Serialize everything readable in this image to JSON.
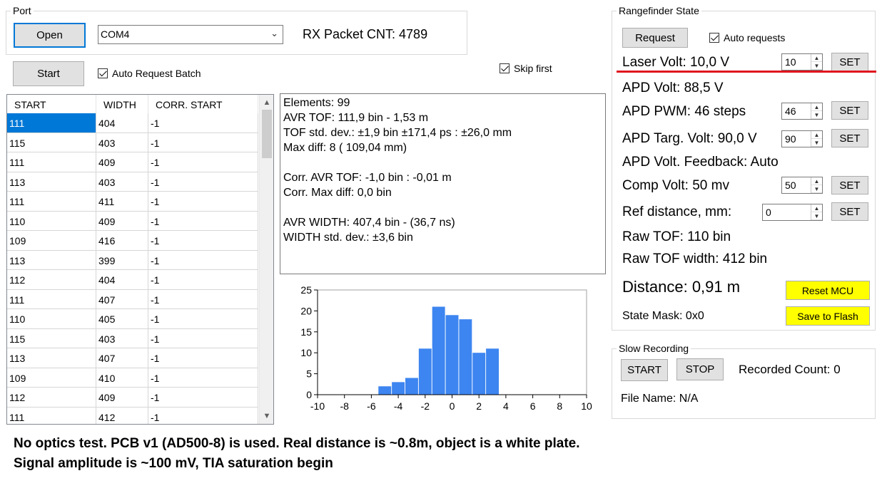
{
  "port": {
    "group_title": "Port",
    "open_label": "Open",
    "com_value": "COM4",
    "rx_packet": "RX Packet CNT: 4789",
    "start_label": "Start",
    "auto_request_batch": "Auto Request Batch",
    "skip_first": "Skip first"
  },
  "table": {
    "columns": [
      "START",
      "WIDTH",
      "CORR. START"
    ],
    "rows": [
      [
        "111",
        "404",
        "-1"
      ],
      [
        "115",
        "403",
        "-1"
      ],
      [
        "111",
        "409",
        "-1"
      ],
      [
        "113",
        "403",
        "-1"
      ],
      [
        "111",
        "411",
        "-1"
      ],
      [
        "110",
        "409",
        "-1"
      ],
      [
        "109",
        "416",
        "-1"
      ],
      [
        "113",
        "399",
        "-1"
      ],
      [
        "112",
        "404",
        "-1"
      ],
      [
        "111",
        "407",
        "-1"
      ],
      [
        "110",
        "405",
        "-1"
      ],
      [
        "115",
        "403",
        "-1"
      ],
      [
        "113",
        "407",
        "-1"
      ],
      [
        "109",
        "410",
        "-1"
      ],
      [
        "112",
        "409",
        "-1"
      ],
      [
        "111",
        "412",
        "-1"
      ]
    ]
  },
  "stats": {
    "elements": "Elements: 99",
    "avr_tof": "AVR TOF: 111,9 bin - 1,53  m",
    "tof_std": "TOF std. dev.: ±1,9 bin ±171,4 ps : ±26,0 mm",
    "max_diff": "Max diff: 8 ( 109,04 mm)",
    "corr_avr_tof": "Corr. AVR TOF: -1,0 bin : -0,01  m",
    "corr_max_diff": "Corr. Max diff: 0,0 bin",
    "avr_width": "AVR WIDTH: 407,4 bin - (36,7 ns)",
    "width_std": "WIDTH std. dev.: ±3,6 bin"
  },
  "chart_data": {
    "type": "bar",
    "title": "",
    "xlabel": "",
    "ylabel": "",
    "x": [
      -5,
      -4,
      -3,
      -2,
      -1,
      0,
      1,
      2,
      3
    ],
    "values": [
      2,
      3,
      4,
      11,
      21,
      19,
      18,
      10,
      11
    ],
    "xlim": [
      -10,
      10
    ],
    "ylim": [
      0,
      25
    ],
    "x_ticks": [
      "-10",
      "-8",
      "-6",
      "-4",
      "-2",
      "0",
      "2",
      "4",
      "6",
      "8",
      "10"
    ],
    "y_ticks": [
      "0",
      "5",
      "10",
      "15",
      "20",
      "25"
    ],
    "bar_color": "#3d85f0",
    "grid": false
  },
  "rangefinder": {
    "group_title": "Rangefinder State",
    "request_label": "Request",
    "auto_requests": "Auto requests",
    "laser_volt": "Laser Volt: 10,0 V",
    "laser_volt_input": "10",
    "apd_volt": "APD Volt: 88,5 V",
    "apd_pwm": "APD PWM: 46 steps",
    "apd_pwm_input": "46",
    "apd_targ_volt": "APD Targ. Volt: 90,0 V",
    "apd_targ_input": "90",
    "apd_feedback": "APD Volt. Feedback: Auto",
    "comp_volt": "Comp Volt: 50 mv",
    "comp_volt_input": "50",
    "ref_distance": "Ref distance, mm:",
    "ref_distance_input": "0",
    "raw_tof": "Raw TOF:  110 bin",
    "raw_tof_width": "Raw TOF width:  412 bin",
    "distance": "Distance: 0,91 m",
    "state_mask": "State Mask: 0x0",
    "set_label": "SET",
    "reset_mcu": "Reset MCU",
    "save_flash": "Save to Flash",
    "highlight_color": "#e0141e"
  },
  "slow_recording": {
    "group_title": "Slow Recording",
    "start_label": "START",
    "stop_label": "STOP",
    "recorded_count": "Recorded Count: 0",
    "file_name": "File Name: N/A"
  },
  "notes": {
    "line1": "No optics test. PCB v1 (AD500-8) is used. Real distance is ~0.8m, object is a white plate.",
    "line2": "Signal amplitude is ~100 mV, TIA saturation begin"
  }
}
